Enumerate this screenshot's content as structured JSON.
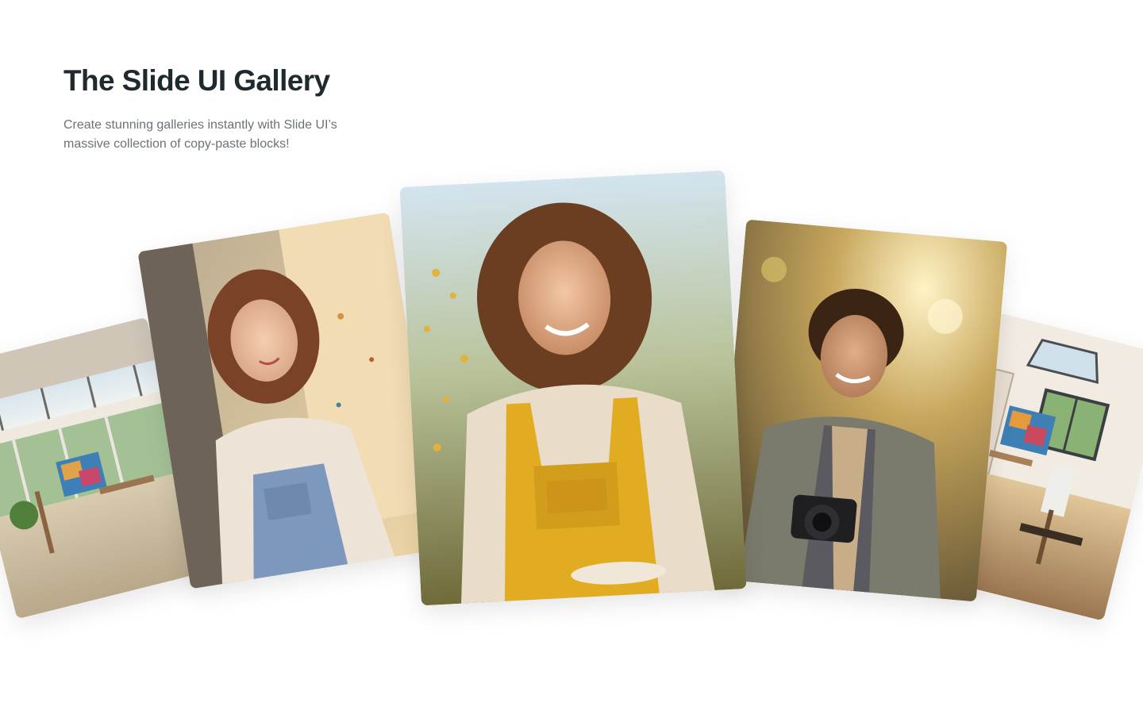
{
  "hero": {
    "title": "The Slide UI Gallery",
    "subtitle": "Create stunning galleries instantly with Slide UI’s massive collection of copy-paste blocks!"
  },
  "gallery": {
    "images": [
      {
        "subject": "sunlit art studio with skylights"
      },
      {
        "subject": "smiling woman in overalls at easel"
      },
      {
        "subject": "smiling woman in yellow overalls outdoors"
      },
      {
        "subject": "smiling man holding a camera"
      },
      {
        "subject": "bright art studio with easels"
      }
    ]
  }
}
